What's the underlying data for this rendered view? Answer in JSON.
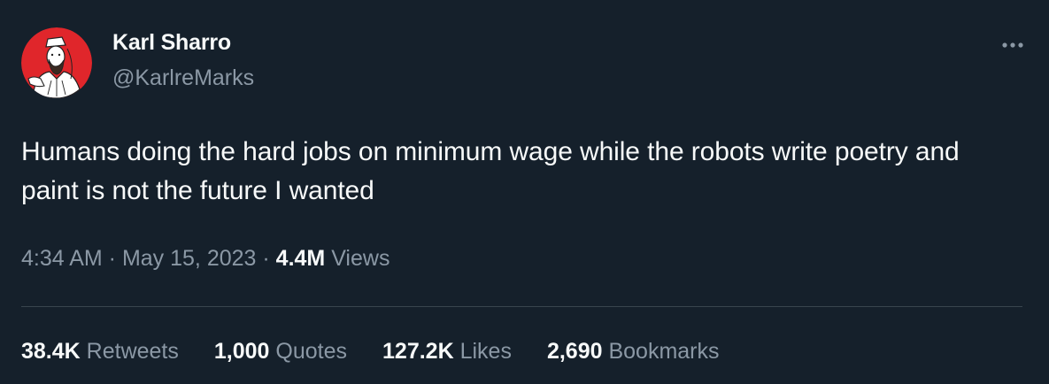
{
  "author": {
    "name": "Karl Sharro",
    "handle": "@KarlreMarks",
    "avatar_icon": "illustrated-portrait-avatar",
    "avatar_bg": "#e0262b"
  },
  "more_icon": "more-dots-icon",
  "tweet": {
    "text": "Humans doing the hard jobs on minimum wage while the robots write poetry and paint is not the future I wanted"
  },
  "meta": {
    "time": "4:34 AM",
    "separator": " · ",
    "date": "May 15, 2023",
    "views_count": "4.4M",
    "views_label": " Views"
  },
  "stats": {
    "retweets": {
      "count": "38.4K",
      "label": " Retweets"
    },
    "quotes": {
      "count": "1,000",
      "label": " Quotes"
    },
    "likes": {
      "count": "127.2K",
      "label": " Likes"
    },
    "bookmarks": {
      "count": "2,690",
      "label": " Bookmarks"
    }
  },
  "colors": {
    "background": "#15202b",
    "primary_text": "#f7f9f9",
    "secondary_text": "#8b98a5",
    "divider": "#38444d"
  }
}
